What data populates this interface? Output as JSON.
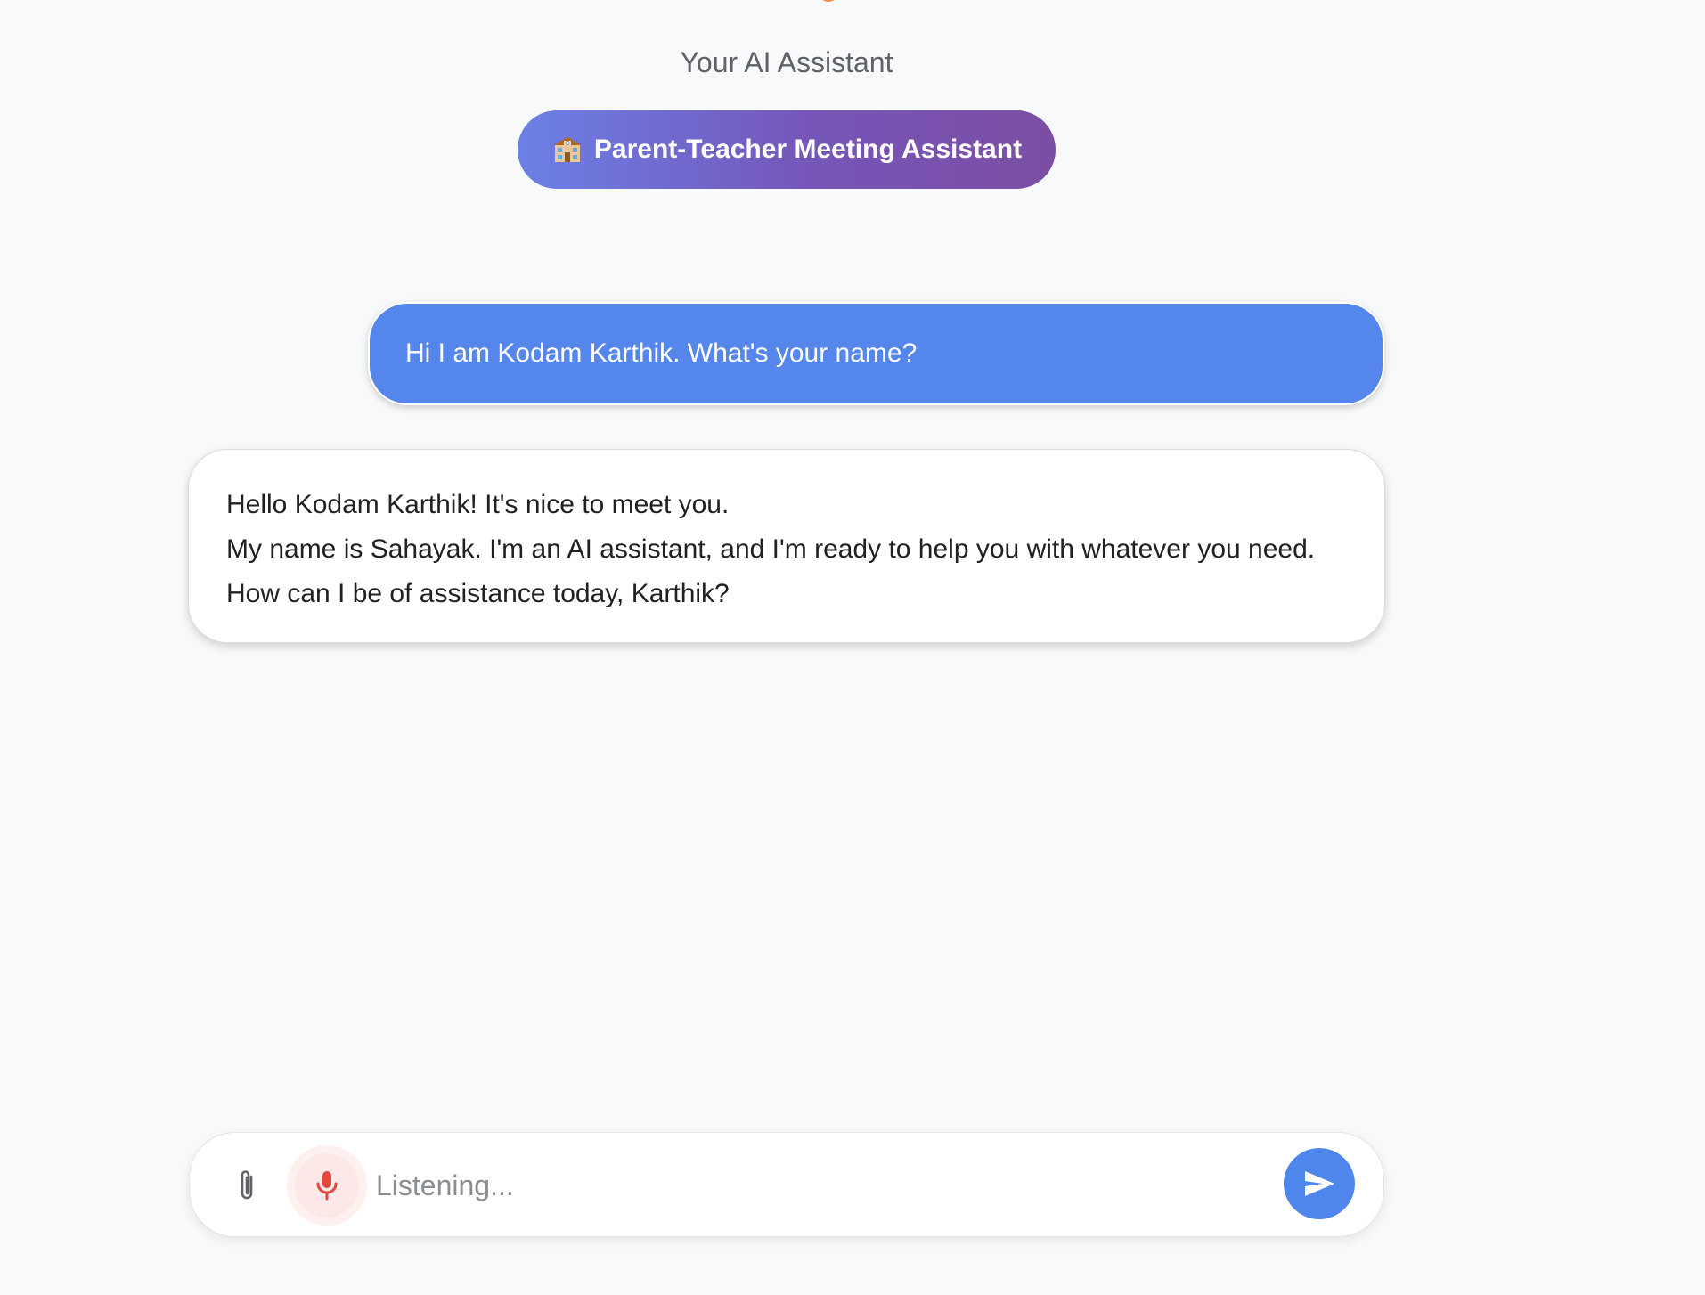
{
  "header": {
    "subtitle": "Your AI Assistant",
    "mode_label": "Parent-Teacher Meeting Assistant",
    "mode_icon": "school-building-icon"
  },
  "messages": [
    {
      "role": "user",
      "text": "Hi I am Kodam Karthik. What's your name?"
    },
    {
      "role": "assistant",
      "lines": [
        "Hello Kodam Karthik! It's nice to meet you.",
        "My name is Sahayak. I'm an AI assistant, and I'm ready to help you with whatever you need. How can I be of assistance today, Karthik?"
      ]
    }
  ],
  "composer": {
    "placeholder": "Listening...",
    "value": "",
    "attach_icon": "paperclip-icon",
    "mic_icon": "microphone-icon",
    "mic_state": "listening",
    "send_icon": "send-icon"
  },
  "colors": {
    "background": "#f8f9fa",
    "user_bubble": "#5586ec",
    "send_button": "#4f86ec",
    "mic_active": "#e8453c",
    "pill_gradient_start": "#6b80e6",
    "pill_gradient_end": "#7b4ea4"
  }
}
